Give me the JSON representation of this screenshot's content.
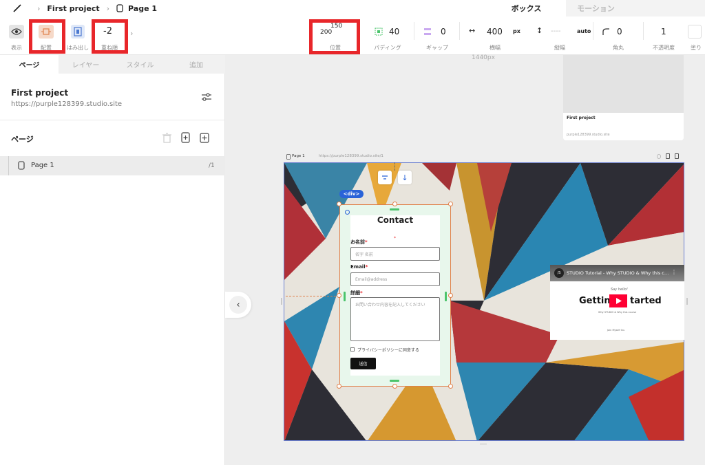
{
  "breadcrumb": {
    "project": "First project",
    "page": "Page 1"
  },
  "mode_tabs": [
    {
      "label": "ボックス",
      "active": true
    },
    {
      "label": "モーション",
      "active": false
    }
  ],
  "toolbar": {
    "display_label": "表示",
    "layout_label": "配置",
    "overflow_label": "はみ出し",
    "zindex_value": "-2",
    "zindex_label": "重ね順",
    "position_x": "200",
    "position_y": "150",
    "position_label": "位置",
    "padding_value": "40",
    "padding_label": "パディング",
    "gap_value": "0",
    "gap_label": "ギャップ",
    "width_value": "400",
    "width_unit": "px",
    "width_label": "横幅",
    "height_value": "----",
    "height_unit": "auto",
    "height_label": "縦幅",
    "radius_value": "0",
    "radius_label": "角丸",
    "opacity_value": "1",
    "opacity_label": "不透明度",
    "fill_label": "塗り"
  },
  "left_tabs": [
    {
      "label": "ページ",
      "active": true
    },
    {
      "label": "レイヤー",
      "active": false
    },
    {
      "label": "スタイル",
      "active": false
    },
    {
      "label": "追加",
      "active": false
    }
  ],
  "project": {
    "name": "First project",
    "url": "https://purple128399.studio.site"
  },
  "pages_section": {
    "title": "ページ"
  },
  "pages": [
    {
      "name": "Page 1",
      "path": "/1"
    }
  ],
  "canvas": {
    "width_label": "1440px",
    "preview": {
      "title": "First project",
      "url": "purple128399.studio.site"
    },
    "frame_page": "Page 1",
    "frame_url": "https://purple128399.studio.site/1"
  },
  "selection_tag": "<div>",
  "form": {
    "title": "Contact",
    "name_label": "お名前",
    "name_placeholder": "名字 名前",
    "email_label": "Email",
    "email_placeholder": "Email@address",
    "detail_label": "詳細",
    "detail_placeholder": "お問い合わせ内容を記入してください",
    "privacy_label": "プライバシーポリシーに同意する",
    "submit_label": "送信"
  },
  "video": {
    "title": "STUDIO Tutorial - Why STUDIO & Why this c…",
    "script_line": "Say hello!",
    "headline_left": "Getting",
    "headline_right": "tarted",
    "sub": "Why STUDIO & Why this course",
    "foot": "Join Myself Inc."
  },
  "colors": {
    "highlight": "#e8262a",
    "selection": "#e0804a",
    "guide": "#4bc46b",
    "tag": "#2a63d8"
  }
}
